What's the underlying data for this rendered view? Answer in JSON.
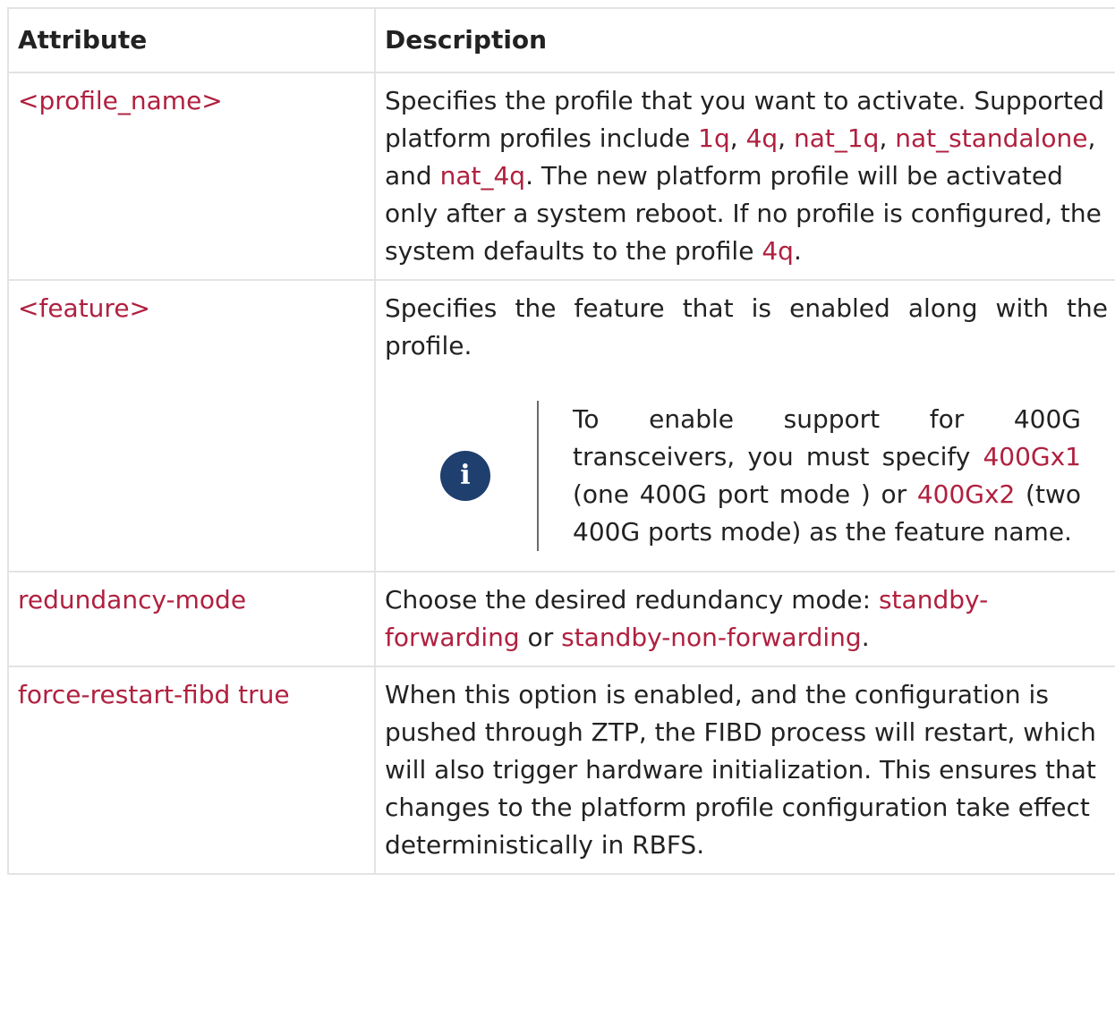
{
  "table": {
    "headers": [
      "Attribute",
      "Description"
    ],
    "rows": [
      {
        "attribute": "<profile_name>",
        "desc": {
          "t1": "Specifies the profile that you want to activate. Supported platform profiles include ",
          "c1": "1q",
          "s1": ", ",
          "c2": "4q",
          "s2": ", ",
          "c3": "nat_1q",
          "s3": ", ",
          "c4": "nat_standalone",
          "s4": ", and ",
          "c5": "nat_4q",
          "t2": ". The new platform profile will be activated only after a system reboot. If no profile is configured, the system defaults to the profile ",
          "c6": "4q",
          "t3": "."
        }
      },
      {
        "attribute": "<feature>",
        "desc": {
          "text": "Specifies the feature that is enabled along with the profile.",
          "note": {
            "icon": "info-icon",
            "t1": "To enable support for 400G transceivers, you must specify ",
            "c1": "400Gx1",
            "t2": " (one 400G port mode ) or ",
            "c2": "400Gx2",
            "t3": " (two 400G ports mode) as the feature name."
          }
        }
      },
      {
        "attribute": "redundancy-mode",
        "desc": {
          "t1": "Choose the desired redundancy mode: ",
          "c1": "standby-forwarding",
          "t2": " or ",
          "c2": "standby-non-forwarding",
          "t3": "."
        }
      },
      {
        "attribute": "force-restart-fibd true",
        "desc": {
          "text": "When this option is enabled, and the configuration is pushed through ZTP, the FIBD process will restart, which will also trigger hardware initialization. This ensures that changes to the platform profile configuration take effect deterministically in RBFS."
        }
      }
    ]
  },
  "colors": {
    "code": "#b0203f",
    "note_icon_bg": "#1f3f6e",
    "border": "#e3e3e3"
  }
}
